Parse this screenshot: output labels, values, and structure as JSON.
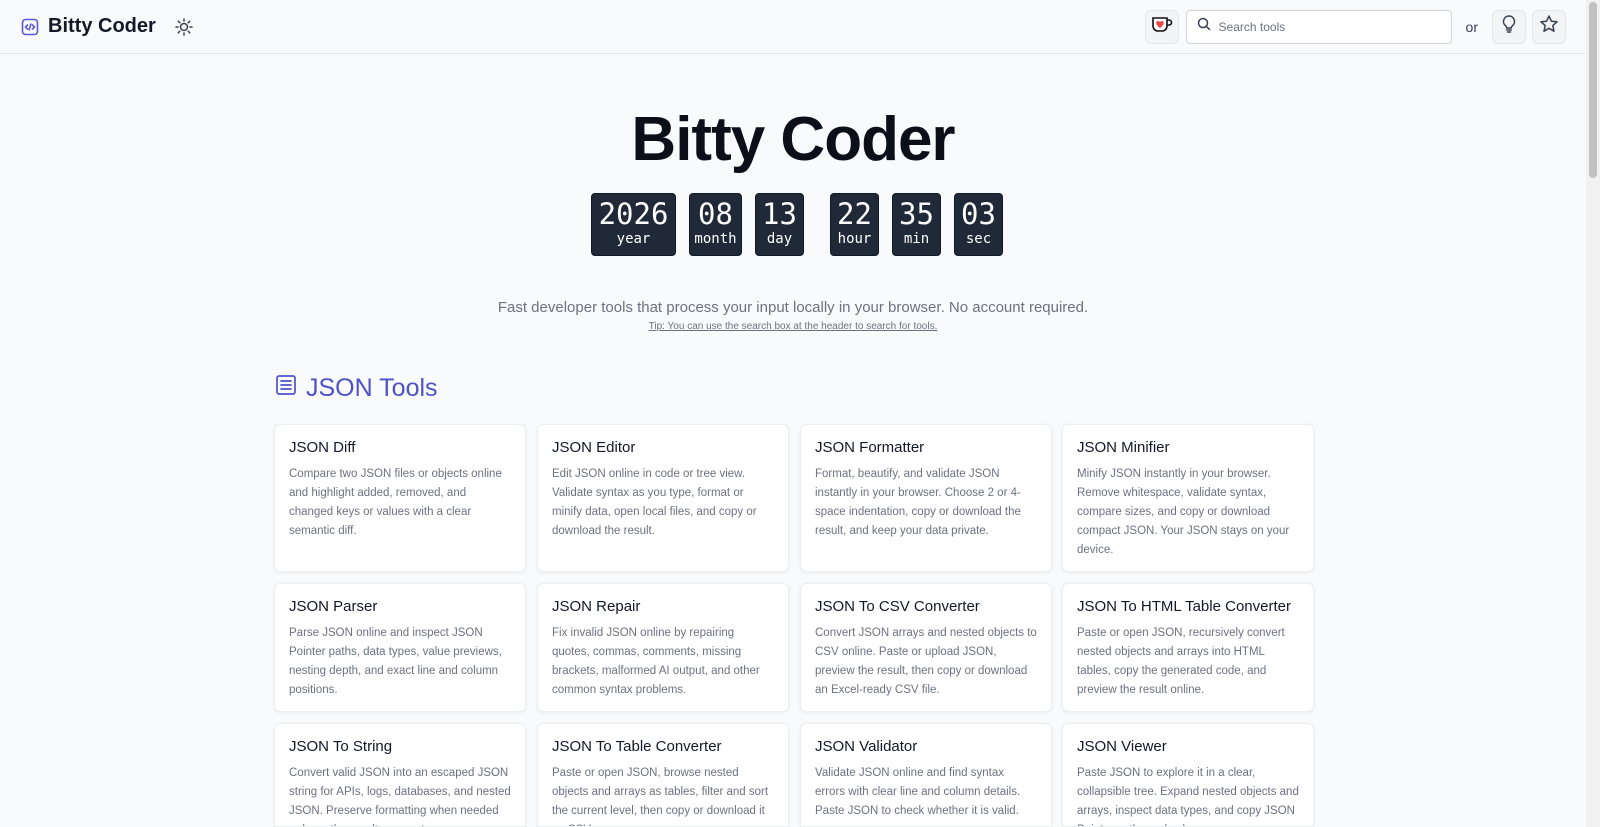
{
  "header": {
    "brand": "Bitty Coder",
    "search_placeholder": "Search tools",
    "or_label": "or"
  },
  "hero": {
    "title": "Bitty Coder",
    "clock": [
      {
        "value": "2026",
        "unit": "year"
      },
      {
        "value": "08",
        "unit": "month"
      },
      {
        "value": "13",
        "unit": "day"
      },
      {
        "value": "22",
        "unit": "hour"
      },
      {
        "value": "35",
        "unit": "min"
      },
      {
        "value": "03",
        "unit": "sec"
      }
    ],
    "subtitle": "Fast developer tools that process your input locally in your browser. No account required.",
    "tip": "Tip: You can use the search box at the header to search for tools."
  },
  "section": {
    "title": "JSON Tools",
    "accent_color": "#4f52c7",
    "cards": [
      {
        "title": "JSON Diff",
        "description": "Compare two JSON files or objects online and highlight added, removed, and changed keys or values with a clear semantic diff."
      },
      {
        "title": "JSON Editor",
        "description": "Edit JSON online in code or tree view. Validate syntax as you type, format or minify data, open local files, and copy or download the result."
      },
      {
        "title": "JSON Formatter",
        "description": "Format, beautify, and validate JSON instantly in your browser. Choose 2 or 4-space indentation, copy or download the result, and keep your data private."
      },
      {
        "title": "JSON Minifier",
        "description": "Minify JSON instantly in your browser. Remove whitespace, validate syntax, compare sizes, and copy or download compact JSON. Your JSON stays on your device."
      },
      {
        "title": "JSON Parser",
        "description": "Parse JSON online and inspect JSON Pointer paths, data types, value previews, nesting depth, and exact line and column positions."
      },
      {
        "title": "JSON Repair",
        "description": "Fix invalid JSON online by repairing quotes, commas, comments, missing brackets, malformed AI output, and other common syntax problems."
      },
      {
        "title": "JSON To CSV Converter",
        "description": "Convert JSON arrays and nested objects to CSV online. Paste or upload JSON, preview the result, then copy or download an Excel-ready CSV file."
      },
      {
        "title": "JSON To HTML Table Converter",
        "description": "Paste or open JSON, recursively convert nested objects and arrays into HTML tables, copy the generated code, and preview the result online."
      },
      {
        "title": "JSON To String",
        "description": "Convert valid JSON into an escaped JSON string for APIs, logs, databases, and nested JSON. Preserve formatting when needed or keep the result compact."
      },
      {
        "title": "JSON To Table Converter",
        "description": "Paste or open JSON, browse nested objects and arrays as tables, filter and sort the current level, then copy or download it as CSV."
      },
      {
        "title": "JSON Validator",
        "description": "Validate JSON online and find syntax errors with clear line and column details. Paste JSON to check whether it is valid."
      },
      {
        "title": "JSON Viewer",
        "description": "Paste JSON to explore it in a clear, collapsible tree. Expand nested objects and arrays, inspect data types, and copy JSON Pointer paths and values."
      }
    ]
  }
}
